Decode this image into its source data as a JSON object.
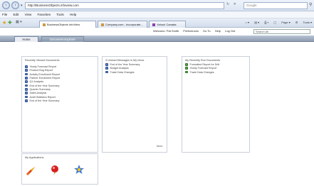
{
  "browser": {
    "url": "http://BusinessObjects.infoview.com",
    "search_placeholder": "Google",
    "menu": [
      "File",
      "Edit",
      "View",
      "Favorites",
      "Tools",
      "Help"
    ],
    "tabs": [
      "BusinessObjects InfoView",
      "Company.com - Incorporate...",
      "Yahoo! Canada"
    ],
    "commands": [
      "Page",
      "Tools"
    ]
  },
  "site": {
    "links": [
      "Welcome: Pat Smith",
      "Preferences",
      "Go To",
      "Help",
      "Log Out"
    ],
    "search_value": "Search All",
    "tabs": [
      "Home",
      "Document Explorer"
    ]
  },
  "panels": {
    "recent": {
      "title": "Recently Viewed Documents",
      "items": [
        "Yearly Forecast Report",
        "Product Bug Report",
        "Activity Enrollment Report",
        "Partner Enrollment Report",
        "Q1 Analysis",
        "End of the Year Summary",
        "Quarter Summary",
        "Sales Analysis",
        "Audit Statistics Report",
        "End of the Year Summary"
      ]
    },
    "inbox": {
      "title": "3 Unread Messages in My Inbox",
      "items": [
        "End of the Year Summary",
        "Budget Analysis",
        "Trade Data Changes"
      ],
      "more": "More"
    },
    "runs": {
      "title": "My Recently Run Documents",
      "items": [
        "Formatted Report for Drill",
        "Yearly Forecast Report",
        "Trade Data Changes"
      ]
    },
    "apps": {
      "title": "My Applications"
    }
  }
}
